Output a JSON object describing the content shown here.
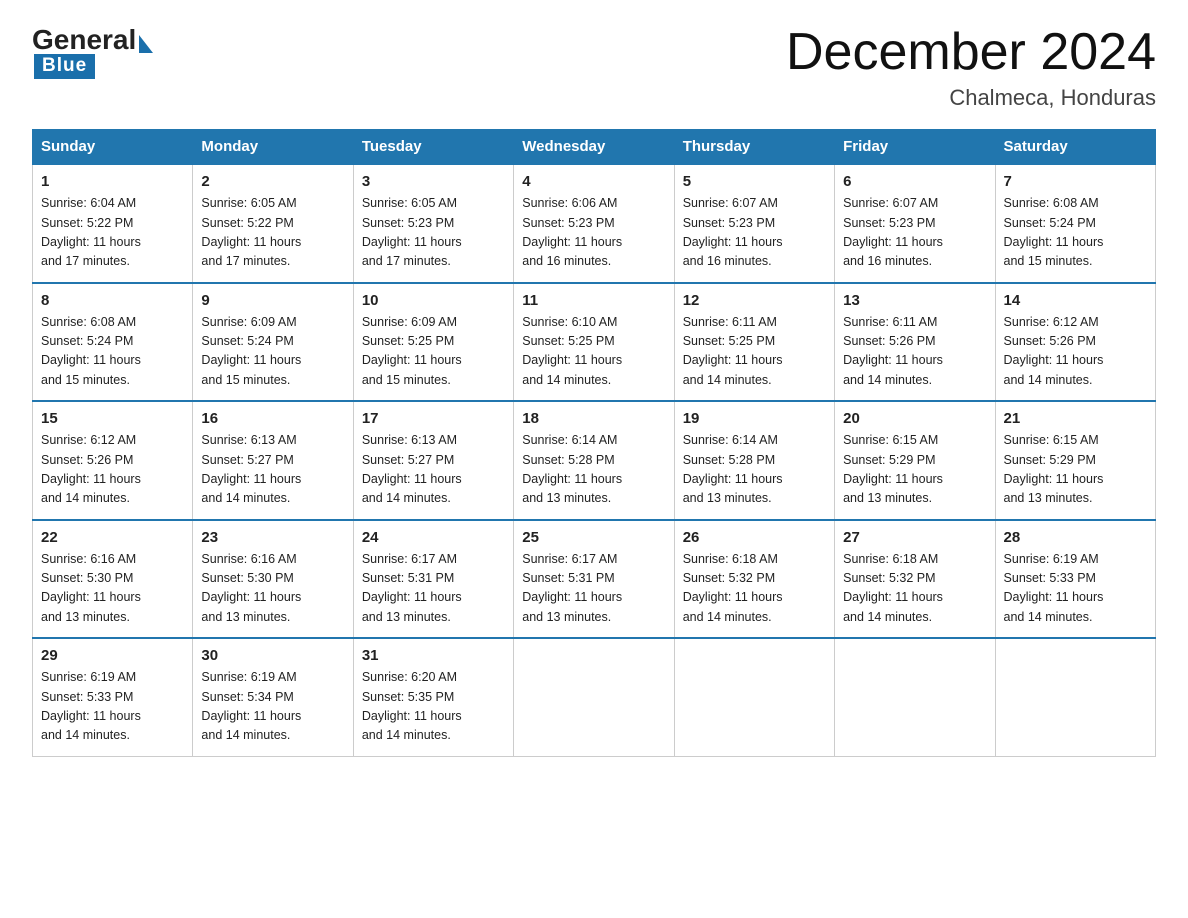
{
  "header": {
    "month_year": "December 2024",
    "location": "Chalmeca, Honduras",
    "logo_general": "General",
    "logo_blue": "Blue"
  },
  "days_of_week": [
    "Sunday",
    "Monday",
    "Tuesday",
    "Wednesday",
    "Thursday",
    "Friday",
    "Saturday"
  ],
  "weeks": [
    [
      {
        "num": "1",
        "sunrise": "6:04 AM",
        "sunset": "5:22 PM",
        "daylight": "11 hours and 17 minutes."
      },
      {
        "num": "2",
        "sunrise": "6:05 AM",
        "sunset": "5:22 PM",
        "daylight": "11 hours and 17 minutes."
      },
      {
        "num": "3",
        "sunrise": "6:05 AM",
        "sunset": "5:23 PM",
        "daylight": "11 hours and 17 minutes."
      },
      {
        "num": "4",
        "sunrise": "6:06 AM",
        "sunset": "5:23 PM",
        "daylight": "11 hours and 16 minutes."
      },
      {
        "num": "5",
        "sunrise": "6:07 AM",
        "sunset": "5:23 PM",
        "daylight": "11 hours and 16 minutes."
      },
      {
        "num": "6",
        "sunrise": "6:07 AM",
        "sunset": "5:23 PM",
        "daylight": "11 hours and 16 minutes."
      },
      {
        "num": "7",
        "sunrise": "6:08 AM",
        "sunset": "5:24 PM",
        "daylight": "11 hours and 15 minutes."
      }
    ],
    [
      {
        "num": "8",
        "sunrise": "6:08 AM",
        "sunset": "5:24 PM",
        "daylight": "11 hours and 15 minutes."
      },
      {
        "num": "9",
        "sunrise": "6:09 AM",
        "sunset": "5:24 PM",
        "daylight": "11 hours and 15 minutes."
      },
      {
        "num": "10",
        "sunrise": "6:09 AM",
        "sunset": "5:25 PM",
        "daylight": "11 hours and 15 minutes."
      },
      {
        "num": "11",
        "sunrise": "6:10 AM",
        "sunset": "5:25 PM",
        "daylight": "11 hours and 14 minutes."
      },
      {
        "num": "12",
        "sunrise": "6:11 AM",
        "sunset": "5:25 PM",
        "daylight": "11 hours and 14 minutes."
      },
      {
        "num": "13",
        "sunrise": "6:11 AM",
        "sunset": "5:26 PM",
        "daylight": "11 hours and 14 minutes."
      },
      {
        "num": "14",
        "sunrise": "6:12 AM",
        "sunset": "5:26 PM",
        "daylight": "11 hours and 14 minutes."
      }
    ],
    [
      {
        "num": "15",
        "sunrise": "6:12 AM",
        "sunset": "5:26 PM",
        "daylight": "11 hours and 14 minutes."
      },
      {
        "num": "16",
        "sunrise": "6:13 AM",
        "sunset": "5:27 PM",
        "daylight": "11 hours and 14 minutes."
      },
      {
        "num": "17",
        "sunrise": "6:13 AM",
        "sunset": "5:27 PM",
        "daylight": "11 hours and 14 minutes."
      },
      {
        "num": "18",
        "sunrise": "6:14 AM",
        "sunset": "5:28 PM",
        "daylight": "11 hours and 13 minutes."
      },
      {
        "num": "19",
        "sunrise": "6:14 AM",
        "sunset": "5:28 PM",
        "daylight": "11 hours and 13 minutes."
      },
      {
        "num": "20",
        "sunrise": "6:15 AM",
        "sunset": "5:29 PM",
        "daylight": "11 hours and 13 minutes."
      },
      {
        "num": "21",
        "sunrise": "6:15 AM",
        "sunset": "5:29 PM",
        "daylight": "11 hours and 13 minutes."
      }
    ],
    [
      {
        "num": "22",
        "sunrise": "6:16 AM",
        "sunset": "5:30 PM",
        "daylight": "11 hours and 13 minutes."
      },
      {
        "num": "23",
        "sunrise": "6:16 AM",
        "sunset": "5:30 PM",
        "daylight": "11 hours and 13 minutes."
      },
      {
        "num": "24",
        "sunrise": "6:17 AM",
        "sunset": "5:31 PM",
        "daylight": "11 hours and 13 minutes."
      },
      {
        "num": "25",
        "sunrise": "6:17 AM",
        "sunset": "5:31 PM",
        "daylight": "11 hours and 13 minutes."
      },
      {
        "num": "26",
        "sunrise": "6:18 AM",
        "sunset": "5:32 PM",
        "daylight": "11 hours and 14 minutes."
      },
      {
        "num": "27",
        "sunrise": "6:18 AM",
        "sunset": "5:32 PM",
        "daylight": "11 hours and 14 minutes."
      },
      {
        "num": "28",
        "sunrise": "6:19 AM",
        "sunset": "5:33 PM",
        "daylight": "11 hours and 14 minutes."
      }
    ],
    [
      {
        "num": "29",
        "sunrise": "6:19 AM",
        "sunset": "5:33 PM",
        "daylight": "11 hours and 14 minutes."
      },
      {
        "num": "30",
        "sunrise": "6:19 AM",
        "sunset": "5:34 PM",
        "daylight": "11 hours and 14 minutes."
      },
      {
        "num": "31",
        "sunrise": "6:20 AM",
        "sunset": "5:35 PM",
        "daylight": "11 hours and 14 minutes."
      },
      null,
      null,
      null,
      null
    ]
  ]
}
